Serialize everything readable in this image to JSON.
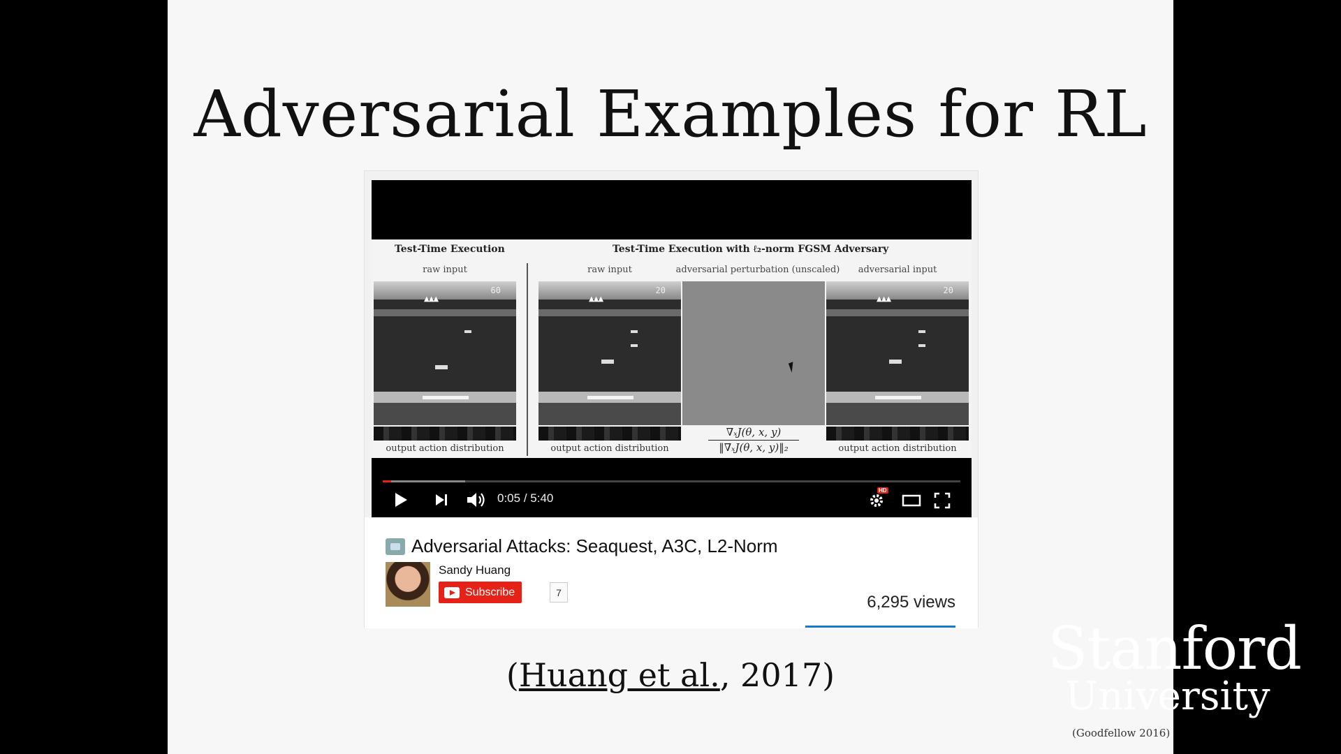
{
  "slide": {
    "title": "Adversarial Examples for RL",
    "citation_prefix": "(",
    "citation_link": "Huang et al.",
    "citation_suffix": ", 2017)",
    "footer_credit": "(Goodfellow 2016)",
    "logo_line1": "Stanford",
    "logo_line2": "University"
  },
  "figure": {
    "left_heading": "Test-Time Execution",
    "right_heading": "Test-Time Execution with ℓ₂-norm FGSM Adversary",
    "raw_input_label": "raw input",
    "raw_input_label_2": "raw input",
    "perturbation_label": "adversarial perturbation (unscaled)",
    "adversarial_input_label": "adversarial input",
    "output_label_1": "output action distribution",
    "output_label_2": "output action distribution",
    "output_label_3": "output action distribution",
    "score_1": "60",
    "score_2": "20",
    "score_3": "20",
    "formula_numerator": "∇ₓJ(θ, x, y)",
    "formula_denominator": "‖∇ₓJ(θ, x, y)‖₂"
  },
  "player": {
    "current_time": "0:05",
    "time_separator": " / ",
    "duration": "5:40",
    "progress_fraction": 0.015,
    "hd_label": "HD",
    "icons": [
      "play-icon",
      "next-icon",
      "volume-icon",
      "settings-icon",
      "theater-icon",
      "fullscreen-icon"
    ]
  },
  "video_info": {
    "title": "Adversarial Attacks: Seaquest, A3C, L2-Norm",
    "channel": "Sandy Huang",
    "subscribe_label": "Subscribe",
    "subscriber_count": "7",
    "views": "6,295 views"
  },
  "colors": {
    "youtube_red": "#e62117",
    "views_bar": "#167ac6"
  }
}
